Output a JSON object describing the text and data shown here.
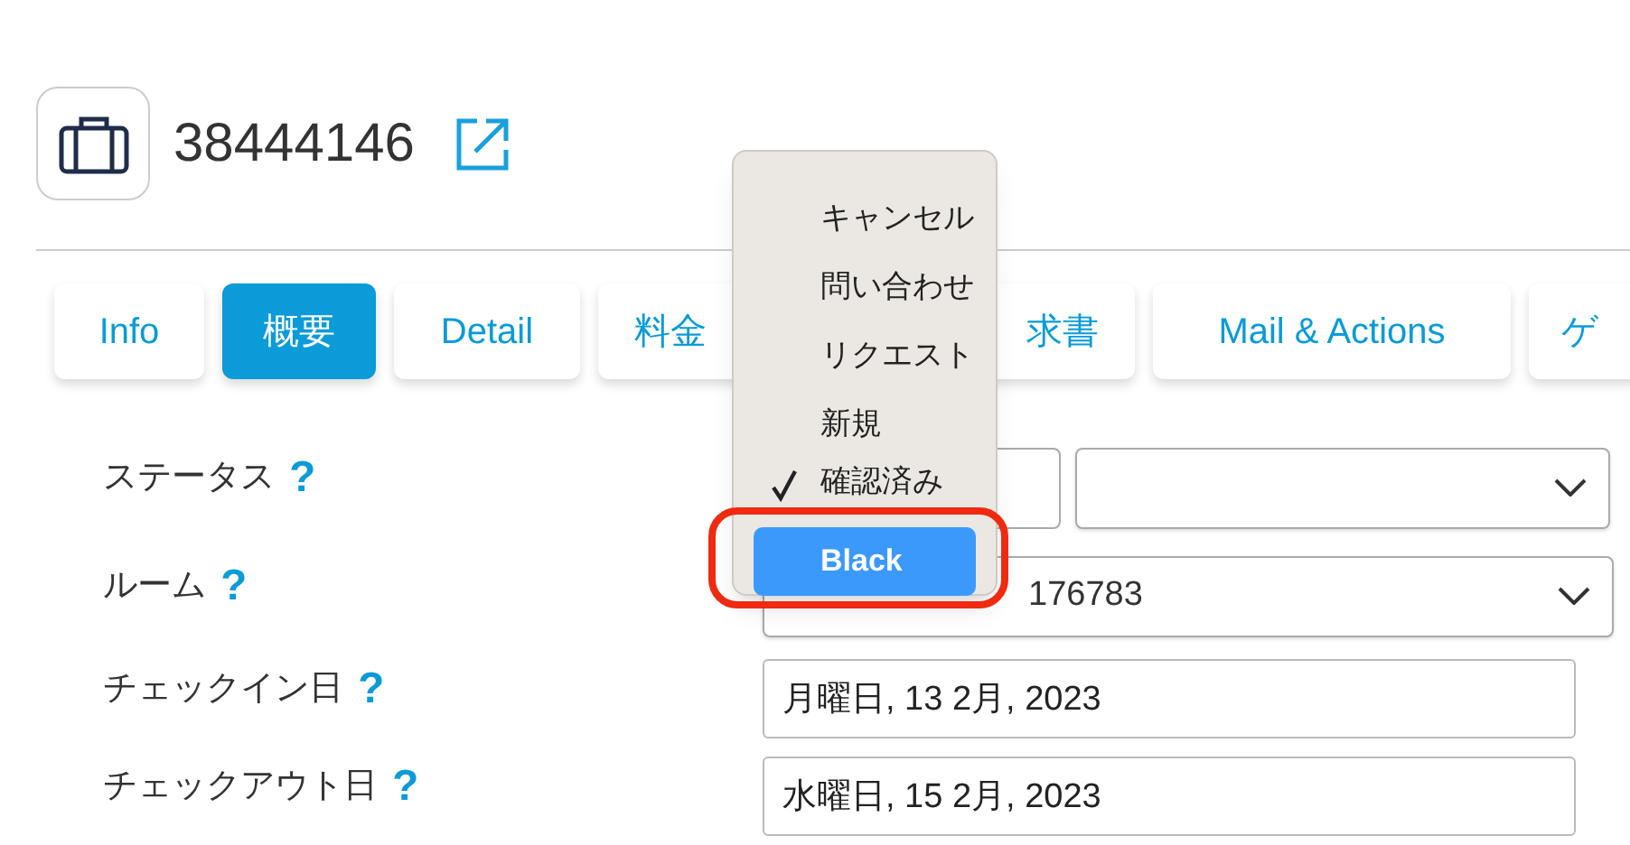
{
  "header": {
    "title": "38444146"
  },
  "tabs": [
    {
      "parts": [
        "Info"
      ],
      "selected": false
    },
    {
      "parts": [
        "概要"
      ],
      "selected": true
    },
    {
      "parts": [
        "Detail"
      ],
      "selected": false
    },
    {
      "parts": [
        "料金",
        "求書"
      ],
      "selected": false
    },
    {
      "parts": [
        "Mail & Actions"
      ],
      "selected": false
    },
    {
      "parts": [
        "ゲ"
      ],
      "selected": false
    }
  ],
  "form": [
    {
      "label": "ステータス",
      "kind": "double-select"
    },
    {
      "label": "ルーム",
      "kind": "select",
      "value": "176783"
    },
    {
      "label": "チェックイン日",
      "kind": "input",
      "value": "月曜日, 13 2月, 2023"
    },
    {
      "label": "チェックアウト日",
      "kind": "input",
      "value": "水曜日, 15 2月, 2023"
    }
  ],
  "help_mark": "?",
  "menu": {
    "items": [
      {
        "label": "キャンセル",
        "checked": false,
        "selected": false
      },
      {
        "label": "問い合わせ",
        "checked": false,
        "selected": false
      },
      {
        "label": "リクエスト",
        "checked": false,
        "selected": false
      },
      {
        "label": "新規",
        "checked": false,
        "selected": false
      },
      {
        "label": "確認済み",
        "checked": true,
        "selected": false
      },
      {
        "label": "Black",
        "checked": false,
        "selected": true
      }
    ]
  }
}
